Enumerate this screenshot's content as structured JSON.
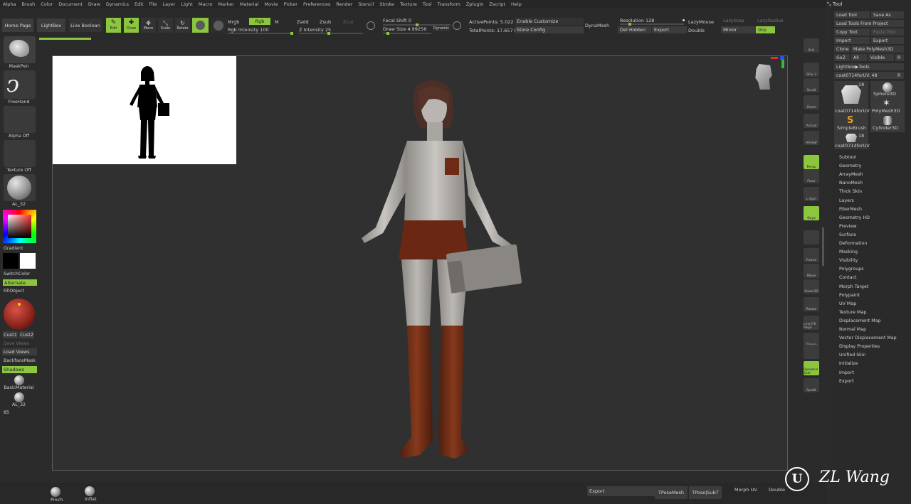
{
  "menu": [
    "Alpha",
    "Brush",
    "Color",
    "Document",
    "Draw",
    "Dynamics",
    "Edit",
    "File",
    "Layer",
    "Light",
    "Macro",
    "Marker",
    "Material",
    "Movie",
    "Picker",
    "Preferences",
    "Render",
    "Stencil",
    "Stroke",
    "Texture",
    "Tool",
    "Transform",
    "Zplugin",
    "Zscript",
    "Help"
  ],
  "toolbar": {
    "home_page": "Home Page",
    "lightbox": "LightBox",
    "live_boolean": "Live Boolean",
    "edit": "Edit",
    "draw": "Draw",
    "move": "Move",
    "scale": "Scale",
    "rotate": "Rotate",
    "mrgb": "Mrgb",
    "rgb": "Rgb",
    "m": "M",
    "rgb_intensity": "Rgb Intensity 100",
    "zadd": "Zadd",
    "zsub": "Zsub",
    "zcut": "Zcut",
    "z_intensity": "Z Intensity 25",
    "focal_shift": "Focal Shift 0",
    "draw_size": "Draw Size 4.99256",
    "dynamic": "Dynamic",
    "active_points": "ActivePoints: 5.022 Mil",
    "total_points": "TotalPoints: 17.657 Mil",
    "enable_customize": "Enable Customize",
    "store_config": "Store Config",
    "dynamesh": "DynaMesh",
    "resolution": "Resolution 128",
    "del_hidden": "Del Hidden",
    "export": "Export",
    "lazymouse": "LazyMouse",
    "double": "Double",
    "lazystep": "LazyStep",
    "lazyradius": "LazyRadius",
    "mirror": "Mirror",
    "grp": "Grp"
  },
  "left": {
    "maskpen": "MaskPen",
    "freehand": "FreeHand",
    "alpha_off": "Alpha Off",
    "texture_off": "Texture Off",
    "al32": "AL_32",
    "gradient": "Gradient",
    "switchcolor": "SwitchColor",
    "alternate": "Alternate",
    "fillobject": "FillObject",
    "cust1": "Cust1",
    "cust2": "Cust2",
    "save_views": "Save Views",
    "load_views": "Load Views",
    "backfacemask": "BackfaceMask",
    "shadows": "Shadows",
    "basicmaterial": "BasicMaterial",
    "al32b": "AL_32",
    "num": "85"
  },
  "right_strip": [
    "Brill",
    "SPix 3",
    "Scroll",
    "Zoom",
    "Actual",
    "AAHalf",
    "Persp",
    "Floor",
    "L.Sym",
    "Qxyz",
    "",
    "Frame",
    "Move",
    "Zoom3D",
    "Rotate",
    "Line Fill PolyF",
    "Transp",
    "",
    "Dynamic Solo",
    "Spotlt"
  ],
  "tool": {
    "title": "Tool",
    "load_tool": "Load Tool",
    "save_as": "Save As",
    "load_from_project": "Load Tools From Project",
    "copy_tool": "Copy Tool",
    "paste_tool": "Paste Tool",
    "import": "Import",
    "export": "Export",
    "clone": "Clone",
    "make_polymesh": "Make PolyMesh3D",
    "goz": "GoZ",
    "all": "All",
    "visible": "Visible",
    "r": "R",
    "lightbox_tools": "Lightbox▶Tools",
    "current": "coat0714forUV. 48",
    "thumbs": [
      {
        "label": "coat0714forUV",
        "count": "18"
      },
      {
        "label": "Sphere3D",
        "count": ""
      },
      {
        "label": "PolyMesh3D",
        "count": ""
      },
      {
        "label": "SimpleBrush",
        "count": ""
      },
      {
        "label": "Cylinder3D",
        "count": ""
      },
      {
        "label": "coat0714forUV",
        "count": "18"
      }
    ],
    "sections": [
      "Subtool",
      "Geometry",
      "ArrayMesh",
      "NanoMesh",
      "Thick Skin",
      "Layers",
      "FiberMesh",
      "Geometry HD",
      "Preview",
      "Surface",
      "Deformation",
      "Masking",
      "Visibility",
      "Polygroups",
      "Contact",
      "Morph Target",
      "Polypaint",
      "UV Map",
      "Texture Map",
      "Displacement Map",
      "Normal Map",
      "Vector Displacement Map",
      "Display Properties",
      "Unified Skin",
      "Initialize",
      "Import",
      "Export"
    ]
  },
  "bottom": {
    "pinch": "Pinch",
    "inflat": "Inflat",
    "export": "Export",
    "tposemesh": "TPoseMesh",
    "tpose_subt": "TPose|SubT",
    "morph_uv": "Morph UV",
    "double": "Double"
  },
  "watermark": "ZL Wang",
  "colors": {
    "accent": "#8cc63f",
    "bg": "#2b2b2b",
    "viewport": "#303030"
  }
}
